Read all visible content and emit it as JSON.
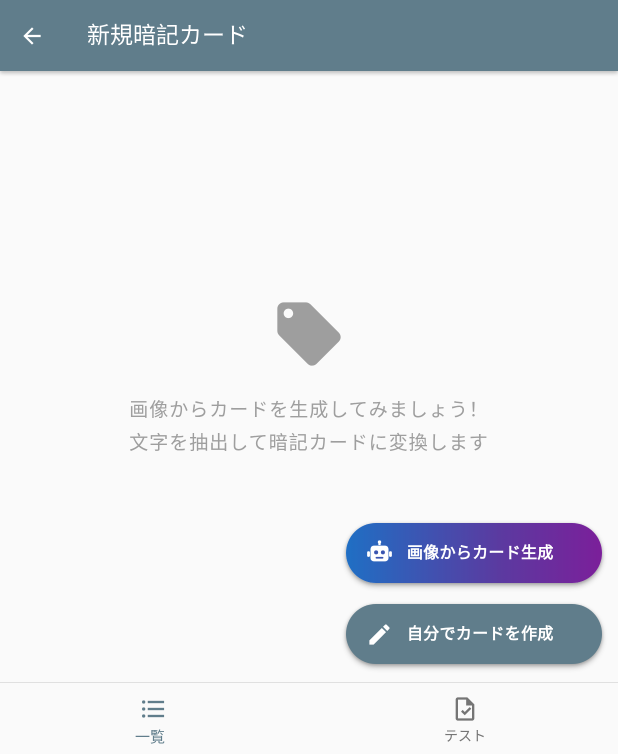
{
  "app_bar": {
    "title": "新規暗記カード",
    "back_icon": "arrow-back-icon",
    "background_color": "#607d8b"
  },
  "empty_state": {
    "icon": "label-tag-icon",
    "lines": [
      "画像からカードを生成してみましょう！",
      "文字を抽出して暗記カードに変換します"
    ]
  },
  "actions": {
    "generate_from_image": {
      "label": "画像からカード生成",
      "icon": "robot-icon",
      "gradient": [
        "#1f6fc4",
        "#7b1f9a"
      ]
    },
    "create_manually": {
      "label": "自分でカードを作成",
      "icon": "pencil-icon",
      "color": "#607d8b"
    }
  },
  "bottom_nav": {
    "items": [
      {
        "label": "一覧",
        "icon": "list-icon",
        "active": true
      },
      {
        "label": "テスト",
        "icon": "checklist-document-icon",
        "active": false
      }
    ]
  }
}
